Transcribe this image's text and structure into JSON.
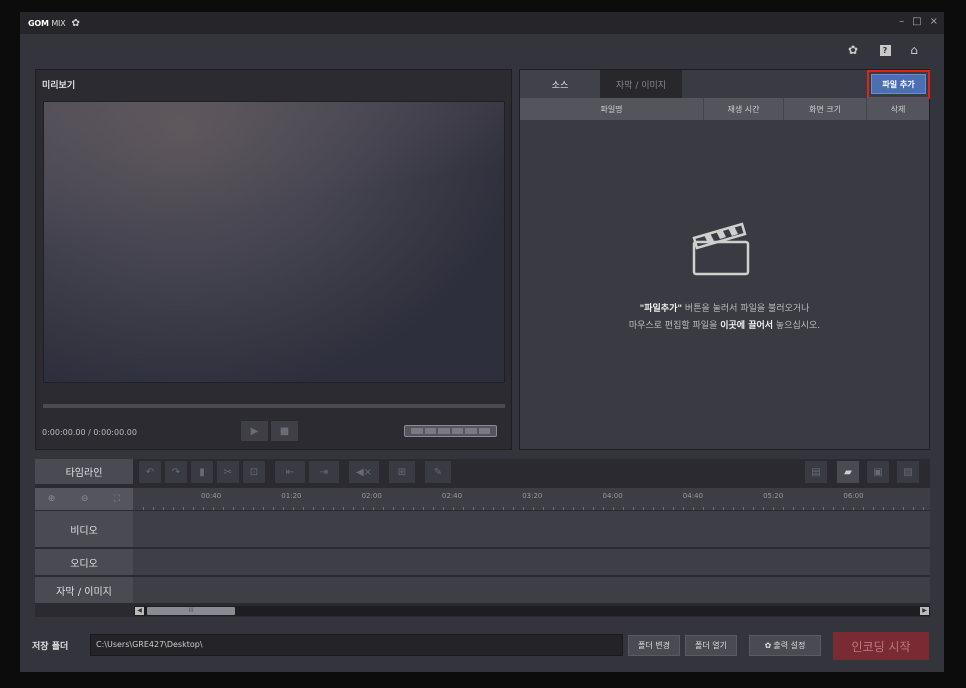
{
  "app": {
    "logo_brand": "GOM",
    "logo_product": "MIX"
  },
  "preview": {
    "title": "미리보기",
    "timecode": "0:00:00.00 / 0:00:00.00"
  },
  "source": {
    "tabs": [
      "소스",
      "자막 / 이미지"
    ],
    "add_file_label": "파일 추가",
    "columns": [
      "파일명",
      "재생 시간",
      "화면 크기",
      "삭제"
    ],
    "empty_line1_bold": "\"파일추가\"",
    "empty_line1_rest": " 버튼을 눌러서 파일을 불러오거나",
    "empty_line2_a": "마우스로 편집할 파일을 ",
    "empty_line2_bold": "이곳에 끌어서",
    "empty_line2_b": " 놓으십시오."
  },
  "timeline": {
    "label": "타임라인",
    "ticks": [
      "00:40",
      "01:20",
      "02:00",
      "02:40",
      "03:20",
      "04:00",
      "04:40",
      "05:20",
      "06:00"
    ],
    "tracks": [
      "비디오",
      "오디오",
      "자막 / 이미지"
    ],
    "scroll_thumb": "III"
  },
  "save": {
    "label": "저장 폴더",
    "path": "C:\\Users\\GRE427\\Desktop\\",
    "change_folder": "폴더 변경",
    "open_folder": "폴더 열기",
    "output_settings": "출력 설정",
    "encode": "인코딩 시작"
  },
  "colors": {
    "accent": "#4b6fb1",
    "highlight": "#e0221d",
    "encode": "#7a2a33"
  }
}
